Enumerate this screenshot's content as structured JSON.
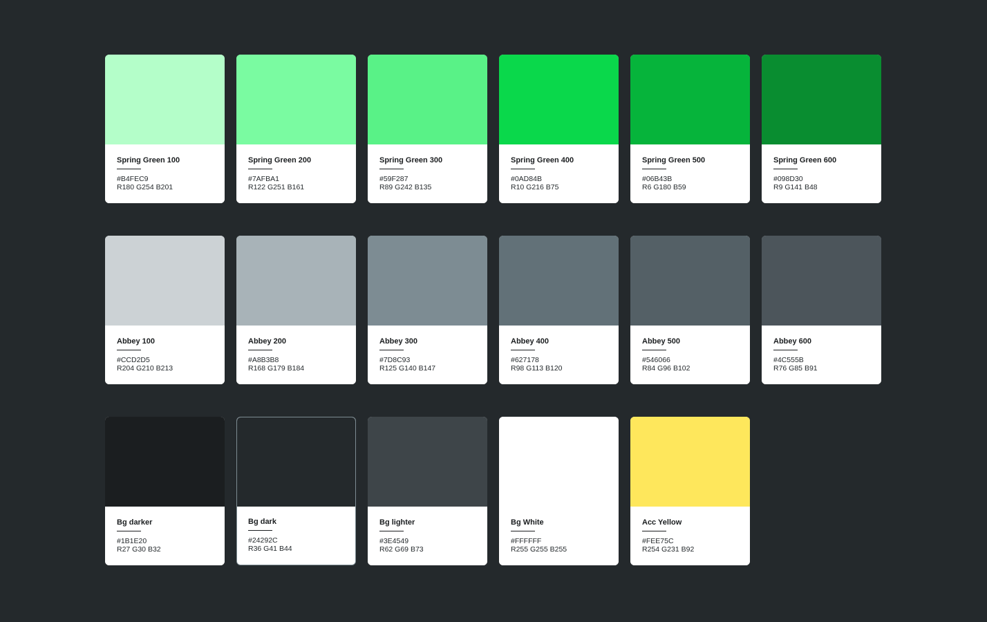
{
  "swatches": [
    {
      "name": "Spring Green 100",
      "hex": "#B4FEC9",
      "rgb": "R180 G254 B201",
      "color": "#B4FEC9"
    },
    {
      "name": "Spring Green 200",
      "hex": "#7AFBA1",
      "rgb": "R122 G251 B161",
      "color": "#7AFBA1"
    },
    {
      "name": "Spring Green 300",
      "hex": "#59F287",
      "rgb": "R89 G242 B135",
      "color": "#59F287"
    },
    {
      "name": "Spring Green 400",
      "hex": "#0AD84B",
      "rgb": "R10 G216 B75",
      "color": "#0AD84B"
    },
    {
      "name": "Spring Green 500",
      "hex": "#06B43B",
      "rgb": "R6 G180 B59",
      "color": "#06B43B"
    },
    {
      "name": "Spring Green 600",
      "hex": "#098D30",
      "rgb": "R9 G141 B48",
      "color": "#098D30"
    },
    {
      "name": "Abbey 100",
      "hex": "#CCD2D5",
      "rgb": "R204 G210 B213",
      "color": "#CCD2D5"
    },
    {
      "name": "Abbey 200",
      "hex": "#A8B3B8",
      "rgb": "R168 G179 B184",
      "color": "#A8B3B8"
    },
    {
      "name": "Abbey 300",
      "hex": "#7D8C93",
      "rgb": "R125 G140 B147",
      "color": "#7D8C93"
    },
    {
      "name": "Abbey 400",
      "hex": "#627178",
      "rgb": "R98 G113 B120",
      "color": "#627178"
    },
    {
      "name": "Abbey 500",
      "hex": "#546066",
      "rgb": "R84 G96 B102",
      "color": "#546066"
    },
    {
      "name": "Abbey 600",
      "hex": "#4C555B",
      "rgb": "R76 G85 B91",
      "color": "#4C555B"
    },
    {
      "name": "Bg darker",
      "hex": "#1B1E20",
      "rgb": "R27 G30 B32",
      "color": "#1B1E20"
    },
    {
      "name": "Bg dark",
      "hex": "#24292C",
      "rgb": "R36 G41 B44",
      "color": "#24292C",
      "outlined": true
    },
    {
      "name": "Bg lighter",
      "hex": "#3E4549",
      "rgb": "R62 G69 B73",
      "color": "#3E4549"
    },
    {
      "name": "Bg White",
      "hex": "#FFFFFF",
      "rgb": "R255 G255 B255",
      "color": "#FFFFFF"
    },
    {
      "name": "Acc Yellow",
      "hex": "#FEE75C",
      "rgb": "R254 G231 B92",
      "color": "#FEE75C"
    }
  ]
}
